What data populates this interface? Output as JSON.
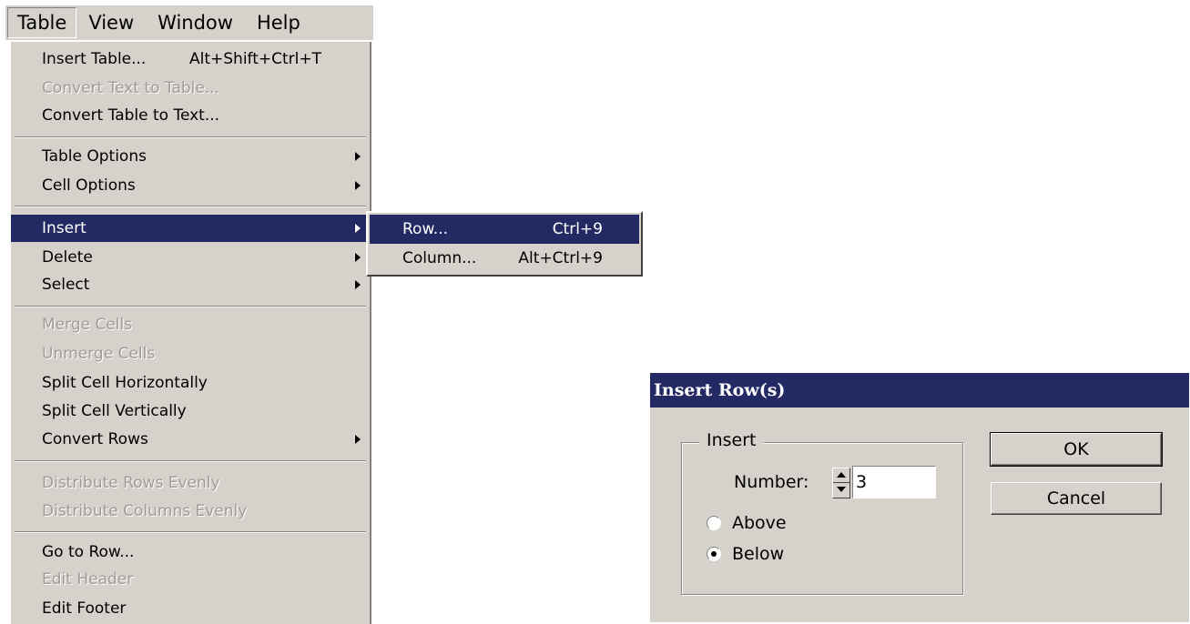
{
  "menubar": {
    "items": [
      {
        "label": "Table"
      },
      {
        "label": "View"
      },
      {
        "label": "Window"
      },
      {
        "label": "Help"
      }
    ]
  },
  "menu": {
    "insert_table": {
      "label": "Insert Table...",
      "shortcut": "Alt+Shift+Ctrl+T"
    },
    "convert_text_to_table": {
      "label": "Convert Text to Table..."
    },
    "convert_table_to_text": {
      "label": "Convert Table to Text..."
    },
    "table_options": {
      "label": "Table Options"
    },
    "cell_options": {
      "label": "Cell Options"
    },
    "insert": {
      "label": "Insert"
    },
    "delete": {
      "label": "Delete"
    },
    "select": {
      "label": "Select"
    },
    "merge_cells": {
      "label": "Merge Cells"
    },
    "unmerge_cells": {
      "label": "Unmerge Cells"
    },
    "split_horizontally": {
      "label": "Split Cell Horizontally"
    },
    "split_vertically": {
      "label": "Split Cell Vertically"
    },
    "convert_rows": {
      "label": "Convert Rows"
    },
    "distribute_rows": {
      "label": "Distribute Rows Evenly"
    },
    "distribute_columns": {
      "label": "Distribute Columns Evenly"
    },
    "go_to_row": {
      "label": "Go to Row..."
    },
    "edit_header": {
      "label": "Edit Header"
    },
    "edit_footer": {
      "label": "Edit Footer"
    }
  },
  "submenu": {
    "row": {
      "label": "Row...",
      "shortcut": "Ctrl+9"
    },
    "column": {
      "label": "Column...",
      "shortcut": "Alt+Ctrl+9"
    }
  },
  "dialog": {
    "title": "Insert Row(s)",
    "group_label": "Insert",
    "number_label": "Number:",
    "number_value": "3",
    "above_label": "Above",
    "below_label": "Below",
    "selected_position": "Below",
    "ok_label": "OK",
    "cancel_label": "Cancel"
  },
  "colors": {
    "highlight": "#232a63",
    "face": "#d6d2cb"
  }
}
